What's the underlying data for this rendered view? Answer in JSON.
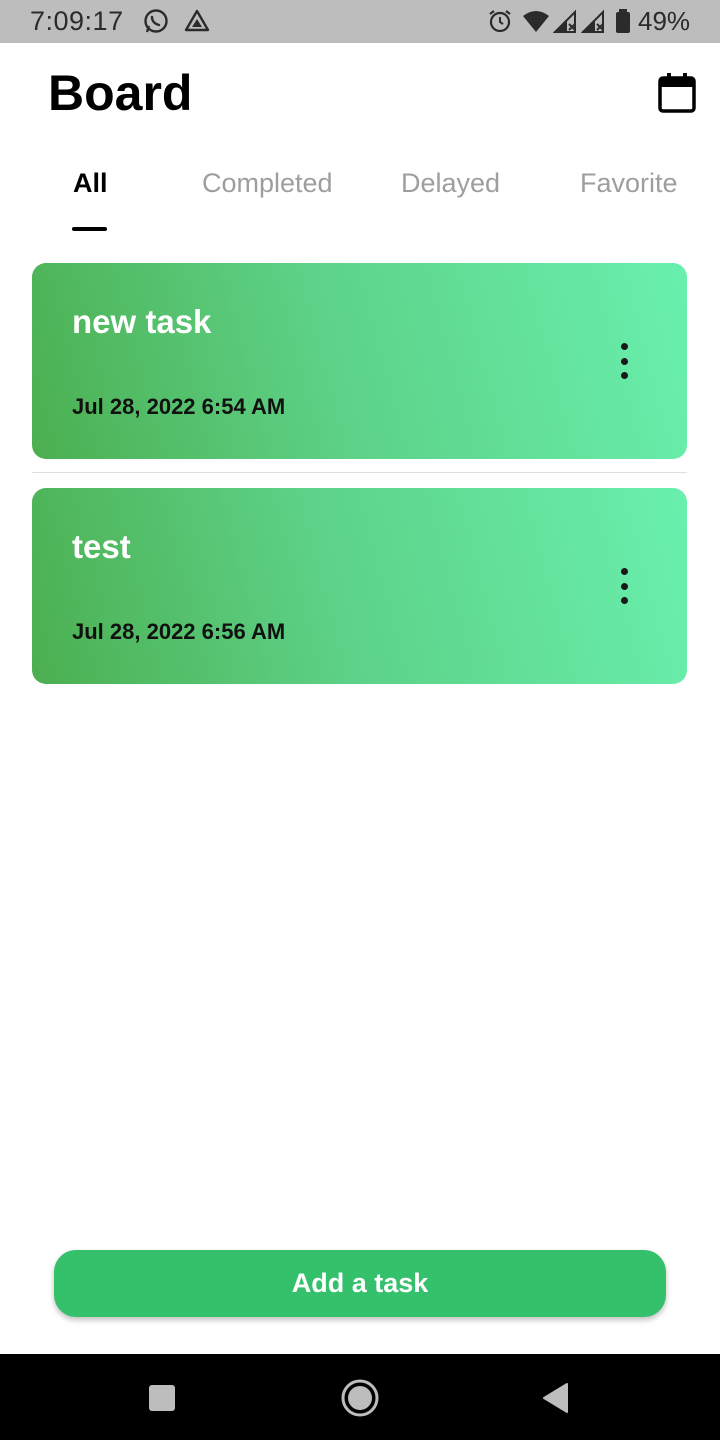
{
  "status_bar": {
    "time": "7:09:17",
    "battery_percent": "49%",
    "left_icons": [
      "whatsapp-icon",
      "drive-icon"
    ],
    "right_icons": [
      "alarm-icon",
      "wifi-icon",
      "signal-icon",
      "signal-icon",
      "battery-icon"
    ]
  },
  "header": {
    "title": "Board",
    "calendar_icon": "calendar-icon"
  },
  "tabs": [
    {
      "label": "All",
      "active": true
    },
    {
      "label": "Completed",
      "active": false
    },
    {
      "label": "Delayed",
      "active": false
    },
    {
      "label": "Favorite",
      "active": false
    }
  ],
  "tasks": [
    {
      "title": "new task",
      "date": "Jul 28, 2022 6:54 AM"
    },
    {
      "title": "test",
      "date": "Jul 28, 2022 6:56 AM"
    }
  ],
  "add_button": {
    "label": "Add a task"
  },
  "colors": {
    "accent": "#35c06c",
    "card_gradient_start": "#4caf50",
    "card_gradient_end": "#69f0ae"
  },
  "nav_bar": {
    "icons": [
      "recents-square-icon",
      "home-circle-icon",
      "back-triangle-icon"
    ]
  }
}
